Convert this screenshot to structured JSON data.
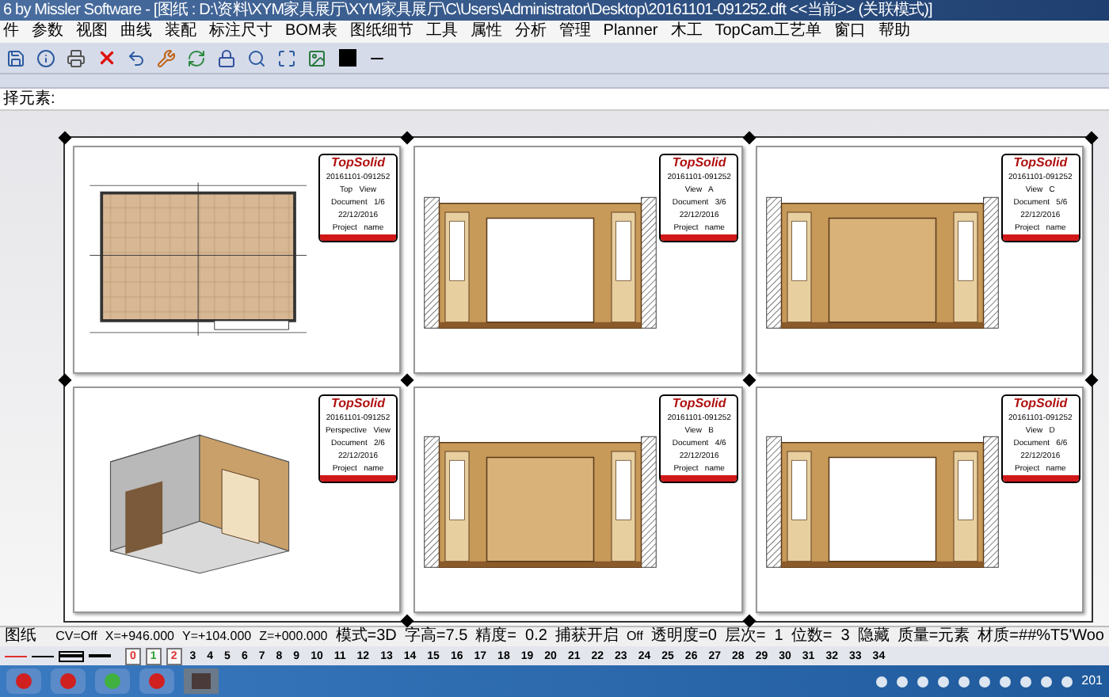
{
  "window": {
    "title": "6 by Missler Software - [图纸 : D:\\资料\\XYM家具展厅\\XYM家具展厅\\C\\Users\\Administrator\\Desktop\\20161101-091252.dft <<当前>> (关联模式)]"
  },
  "menu": [
    "件",
    "参数",
    "视图",
    "曲线",
    "装配",
    "标注尺寸",
    "BOM表",
    "图纸细节",
    "工具",
    "属性",
    "分析",
    "管理",
    "Planner",
    "木工",
    "TopCam工艺单",
    "窗口",
    "帮助"
  ],
  "command": {
    "prompt": "择元素:"
  },
  "views": [
    {
      "kind": "plan",
      "code": "20161101-091252",
      "view": "Top   View",
      "document": "Document   1/6",
      "date": "22/12/2016",
      "project": "Project   name",
      "logo": "TopSolid"
    },
    {
      "kind": "elevation",
      "opening": true,
      "code": "20161101-091252",
      "view": "View   A",
      "document": "Document   3/6",
      "date": "22/12/2016",
      "project": "Project   name",
      "logo": "TopSolid"
    },
    {
      "kind": "elevation",
      "opening": false,
      "code": "20161101-091252",
      "view": "View   C",
      "document": "Document   5/6",
      "date": "22/12/2016",
      "project": "Project   name",
      "logo": "TopSolid"
    },
    {
      "kind": "perspective",
      "code": "20161101-091252",
      "view": "Perspective   View",
      "document": "Document   2/6",
      "date": "22/12/2016",
      "project": "Project   name",
      "logo": "TopSolid"
    },
    {
      "kind": "elevation",
      "opening": false,
      "code": "20161101-091252",
      "view": "View   B",
      "document": "Document   4/6",
      "date": "22/12/2016",
      "project": "Project   name",
      "logo": "TopSolid"
    },
    {
      "kind": "elevation",
      "opening": true,
      "code": "20161101-091252",
      "view": "View   D",
      "document": "Document   6/6",
      "date": "22/12/2016",
      "project": "Project   name",
      "logo": "TopSolid"
    }
  ],
  "status_bar": {
    "mode": "图纸",
    "fields": [
      "CV=Off",
      "X=+946.000",
      "Y=+104.000",
      "Z=+000.000",
      "模式=3D",
      "字高=7.5",
      "精度=  0.2",
      "捕获开启",
      "Off",
      "透明度=0",
      "层次=  1",
      "位数=  3",
      "隐藏",
      "质量=元素",
      "材质=##%T5'Woo"
    ]
  },
  "layers": [
    {
      "label": "0",
      "color": "#e03030"
    },
    {
      "label": "1",
      "color": "#30a030"
    },
    {
      "label": "2",
      "color": "#e03030"
    },
    {
      "label": "3"
    },
    {
      "label": "4"
    },
    {
      "label": "5"
    },
    {
      "label": "6"
    },
    {
      "label": "7"
    },
    {
      "label": "8"
    },
    {
      "label": "9"
    },
    {
      "label": "10"
    },
    {
      "label": "11"
    },
    {
      "label": "12"
    },
    {
      "label": "13"
    },
    {
      "label": "14"
    },
    {
      "label": "15"
    },
    {
      "label": "16"
    },
    {
      "label": "17"
    },
    {
      "label": "18"
    },
    {
      "label": "19"
    },
    {
      "label": "20"
    },
    {
      "label": "21"
    },
    {
      "label": "22"
    },
    {
      "label": "23"
    },
    {
      "label": "24"
    },
    {
      "label": "25"
    },
    {
      "label": "26"
    },
    {
      "label": "27"
    },
    {
      "label": "28"
    },
    {
      "label": "29"
    },
    {
      "label": "30"
    },
    {
      "label": "31"
    },
    {
      "label": "32"
    },
    {
      "label": "33"
    },
    {
      "label": "34"
    }
  ],
  "taskbar": {
    "clock": "201"
  }
}
